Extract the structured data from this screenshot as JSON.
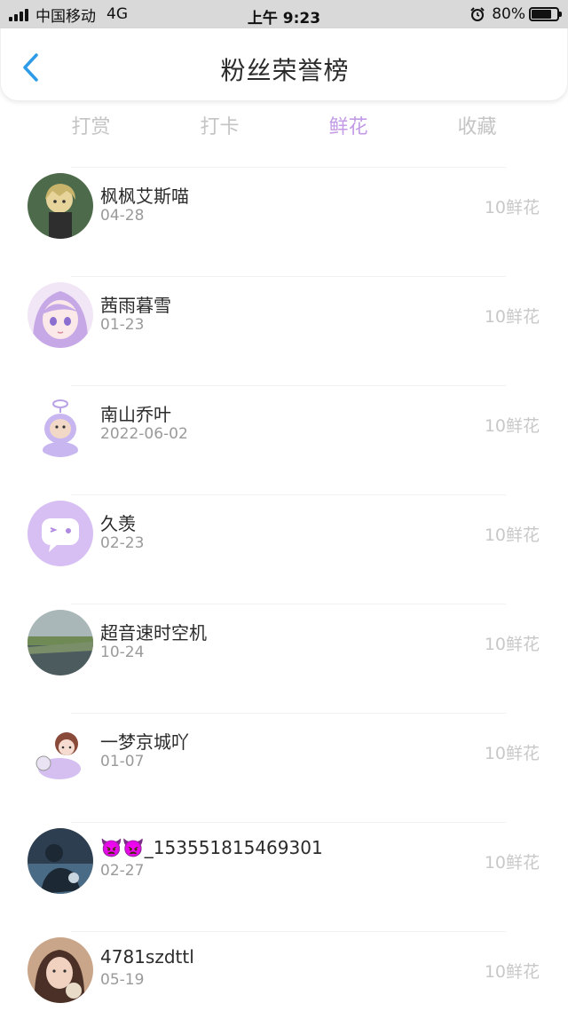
{
  "status_bar": {
    "carrier": "中国移动",
    "network": "4G",
    "time": "上午 9:23",
    "battery_text": "80%",
    "battery_level": 0.8
  },
  "header": {
    "title": "粉丝荣誉榜",
    "back_icon": "chevron-left-icon"
  },
  "colors": {
    "accent": "#c39be6",
    "back": "#2e9be8",
    "tab_inactive": "#c4c4c4"
  },
  "tabs": [
    {
      "label": "打赏",
      "active": false
    },
    {
      "label": "打卡",
      "active": false
    },
    {
      "label": "鲜花",
      "active": true
    },
    {
      "label": "收藏",
      "active": false
    }
  ],
  "fans": [
    {
      "name": "枫枫艾斯喵",
      "date": "04-28",
      "amount": "10鲜花",
      "avatar": "anime-boy-avatar"
    },
    {
      "name": "茜雨暮雪",
      "date": "01-23",
      "amount": "10鲜花",
      "avatar": "anime-girl-avatar"
    },
    {
      "name": "南山乔叶",
      "date": "2022-06-02",
      "amount": "10鲜花",
      "avatar": "teletubby-avatar"
    },
    {
      "name": "久羡",
      "date": "02-23",
      "amount": "10鲜花",
      "avatar": "chat-bubble-avatar"
    },
    {
      "name": "超音速时空机",
      "date": "10-24",
      "amount": "10鲜花",
      "avatar": "landscape-avatar"
    },
    {
      "name": "一梦京城吖",
      "date": "01-07",
      "amount": "10鲜花",
      "avatar": "chibi-avatar"
    },
    {
      "name": "👿👿_153551815469301",
      "date": "02-27",
      "amount": "10鲜花",
      "avatar": "dark-photo-avatar"
    },
    {
      "name": "4781szdttl",
      "date": "05-19",
      "amount": "10鲜花",
      "avatar": "girl-photo-avatar"
    }
  ]
}
